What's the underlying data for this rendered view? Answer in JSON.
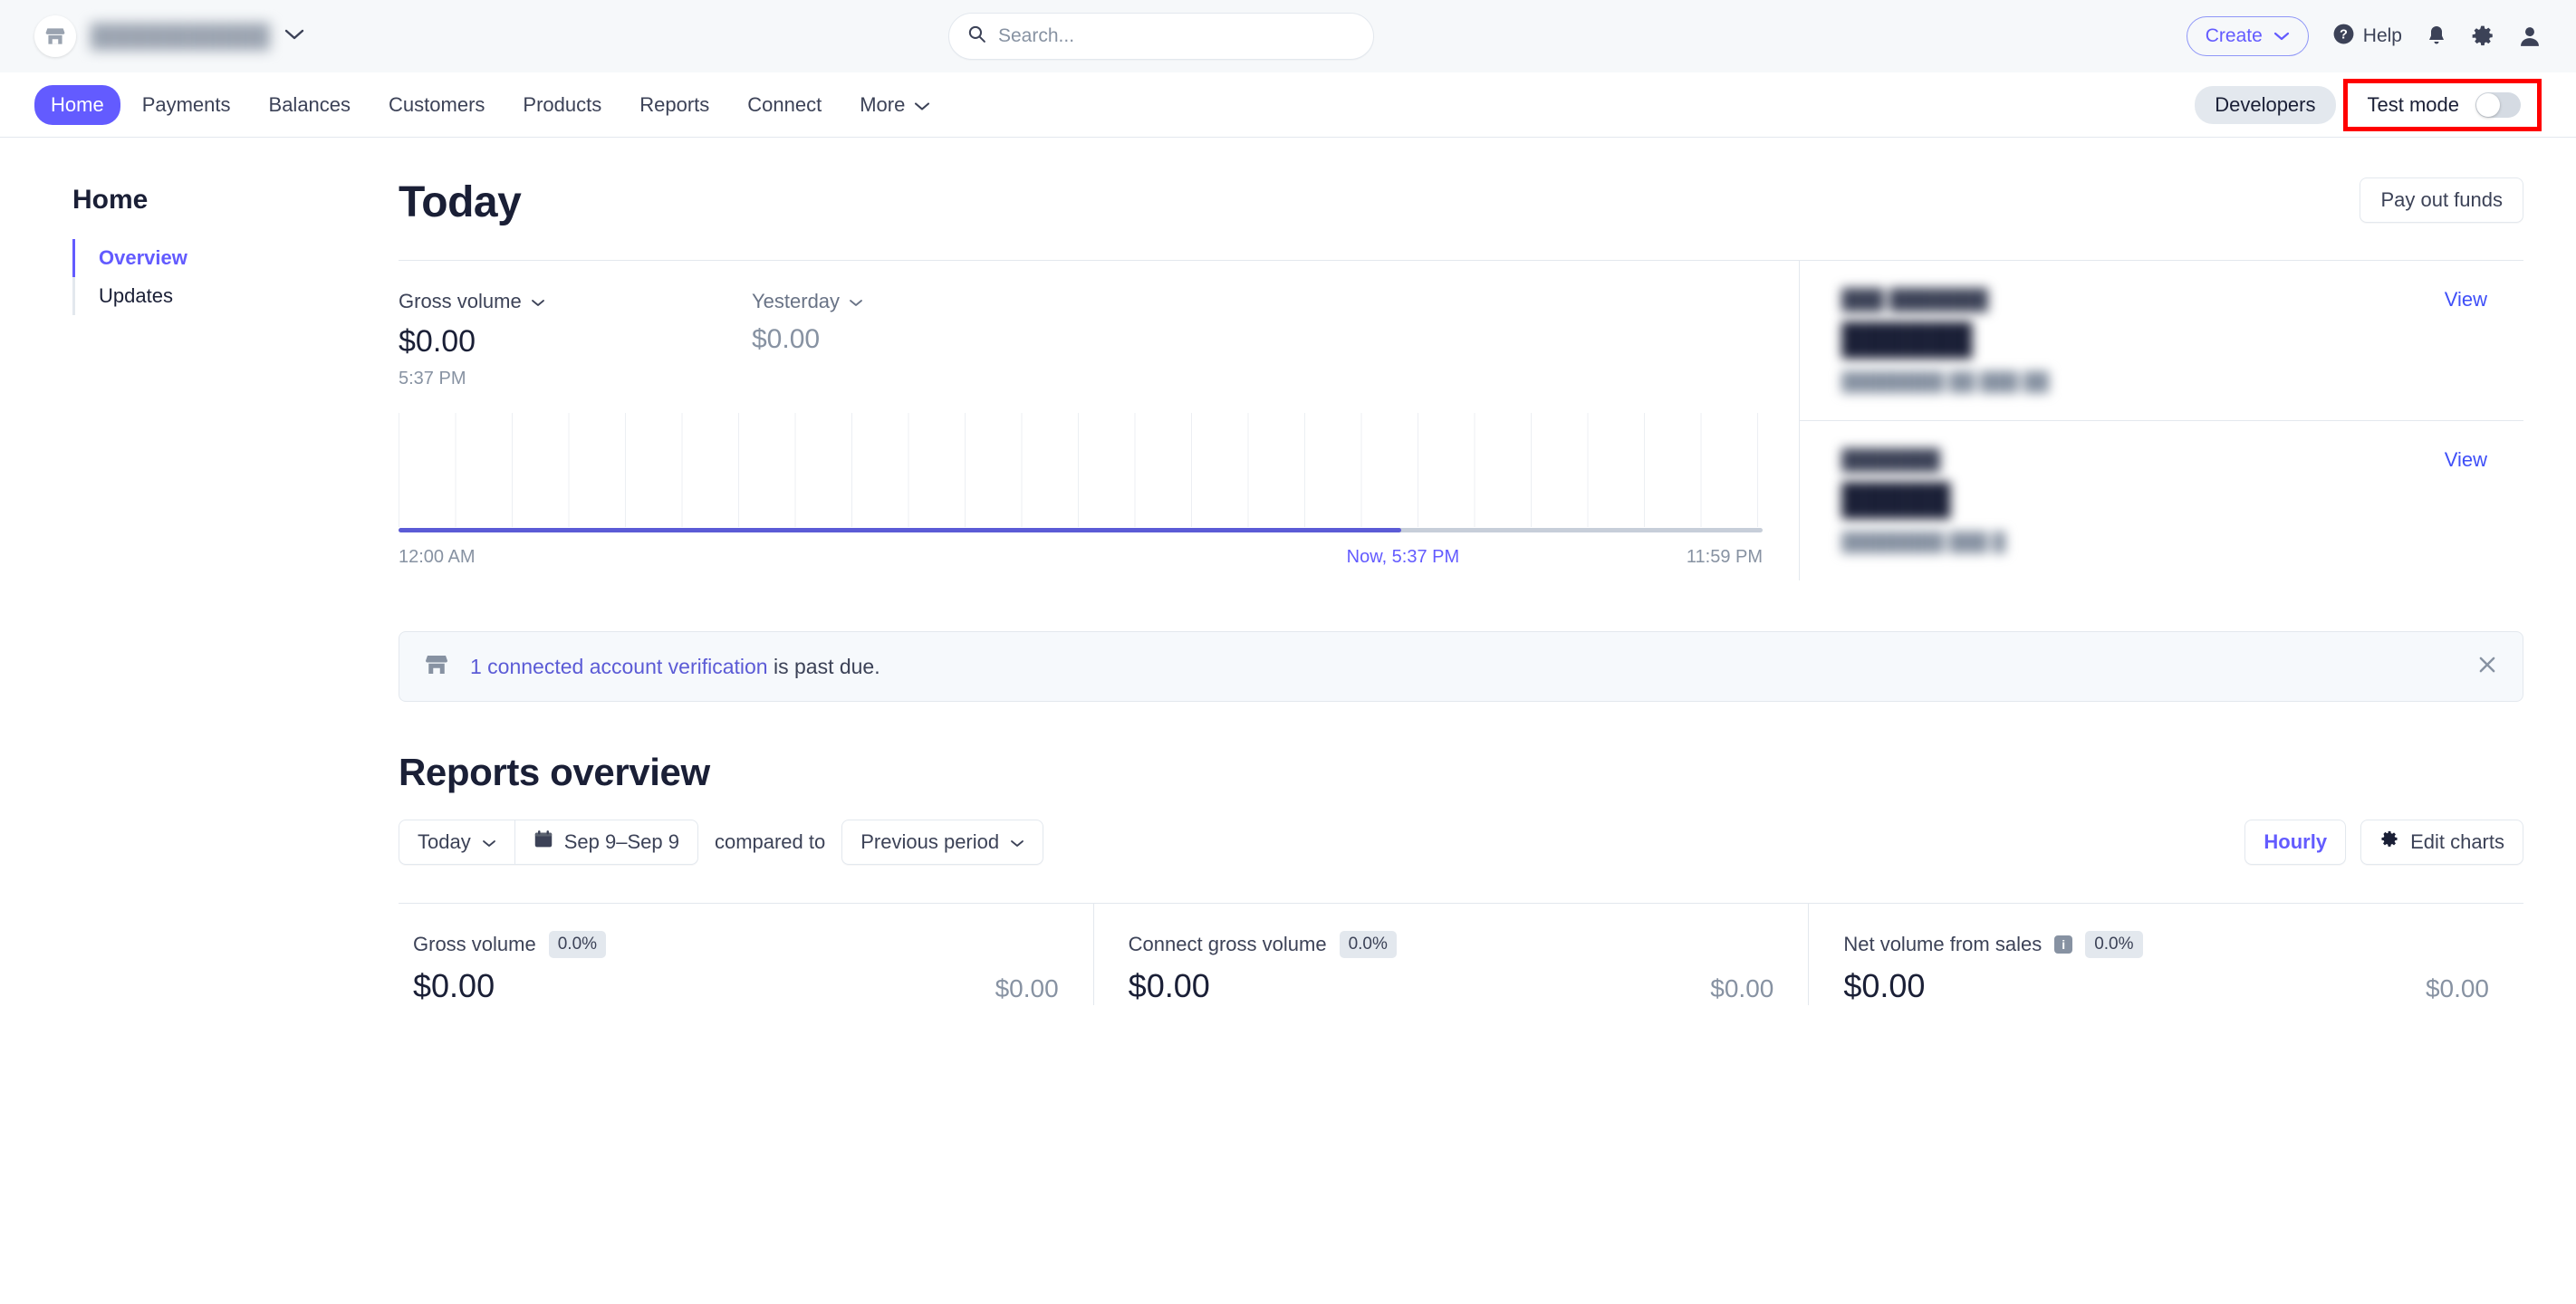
{
  "topbar": {
    "account_name_blurred": "███████████",
    "account_icon": "storefront-icon",
    "search_placeholder": "Search...",
    "search_value": "",
    "create_label": "Create",
    "help_label": "Help",
    "icons": [
      "bell-icon",
      "gear-icon",
      "user-icon"
    ]
  },
  "nav": {
    "tabs": [
      {
        "label": "Home",
        "active": true
      },
      {
        "label": "Payments",
        "active": false
      },
      {
        "label": "Balances",
        "active": false
      },
      {
        "label": "Customers",
        "active": false
      },
      {
        "label": "Products",
        "active": false
      },
      {
        "label": "Reports",
        "active": false
      },
      {
        "label": "Connect",
        "active": false
      },
      {
        "label": "More",
        "active": false,
        "caret": true
      }
    ],
    "developers_label": "Developers",
    "test_mode_label": "Test mode",
    "test_mode_on": false,
    "highlight_color": "#ff0000"
  },
  "sidebar": {
    "title": "Home",
    "items": [
      {
        "label": "Overview",
        "active": true
      },
      {
        "label": "Updates",
        "active": false
      }
    ]
  },
  "today": {
    "title": "Today",
    "payout_button": "Pay out funds",
    "gross_volume": {
      "label": "Gross volume",
      "value": "$0.00",
      "time": "5:37 PM"
    },
    "yesterday": {
      "label": "Yesterday",
      "value": "$0.00"
    },
    "axis": {
      "start": "12:00 AM",
      "now": "Now, 5:37 PM",
      "end": "11:59 PM"
    }
  },
  "balances": [
    {
      "title_blurred": "███ ███████",
      "amount_blurred": "██████",
      "sub_blurred": "████████ ██ ███ ██",
      "view_label": "View"
    },
    {
      "title_blurred": "███████",
      "amount_blurred": "█████",
      "sub_blurred": "████████ ███ █",
      "view_label": "View"
    }
  ],
  "banner": {
    "icon": "storefront-icon",
    "link_text": "1 connected account verification",
    "rest_text": " is past due.",
    "close_icon": "close-icon"
  },
  "reports": {
    "title": "Reports overview",
    "range_label": "Today",
    "date_range": "Sep 9–Sep 9",
    "compared_to_label": "compared to",
    "compare_option": "Previous period",
    "interval_label": "Hourly",
    "edit_charts_label": "Edit charts",
    "cards": [
      {
        "label": "Gross volume",
        "badge": "0.0%",
        "value": "$0.00",
        "compare": "$0.00",
        "info": false
      },
      {
        "label": "Connect gross volume",
        "badge": "0.0%",
        "value": "$0.00",
        "compare": "$0.00",
        "info": false
      },
      {
        "label": "Net volume from sales",
        "badge": "0.0%",
        "value": "$0.00",
        "compare": "$0.00",
        "info": true
      }
    ]
  },
  "chart_data": {
    "type": "line",
    "title": "Gross volume",
    "xlabel": "",
    "ylabel": "",
    "x": [
      "12:00 AM",
      "11:59 PM"
    ],
    "x_ticks": [
      "12:00 AM",
      "Now, 5:37 PM",
      "11:59 PM"
    ],
    "series": [
      {
        "name": "Today",
        "values": [
          0,
          0
        ],
        "color": "#5b5bd6",
        "elapsed_fraction": 0.735
      },
      {
        "name": "Yesterday",
        "values": [
          0,
          0
        ],
        "color": "#c7ced9"
      }
    ],
    "ylim": [
      0,
      0
    ],
    "grid": true,
    "gridline_count": 24,
    "legend": "none"
  }
}
